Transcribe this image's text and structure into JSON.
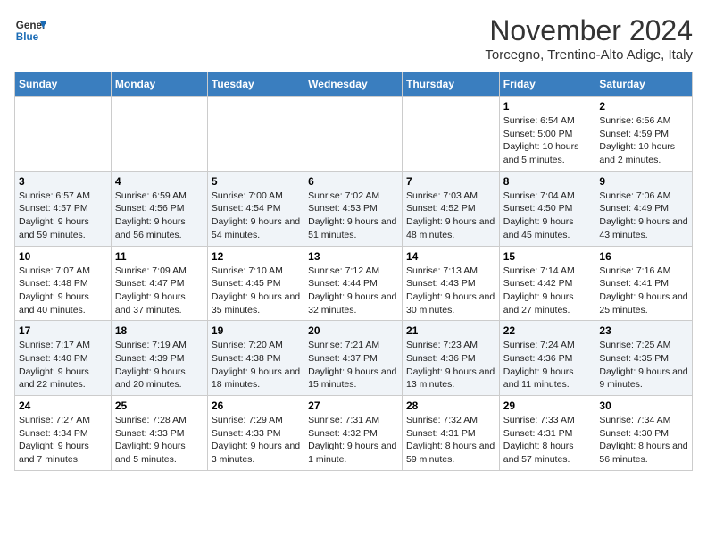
{
  "logo": {
    "line1": "General",
    "line2": "Blue"
  },
  "title": "November 2024",
  "location": "Torcegno, Trentino-Alto Adige, Italy",
  "days_of_week": [
    "Sunday",
    "Monday",
    "Tuesday",
    "Wednesday",
    "Thursday",
    "Friday",
    "Saturday"
  ],
  "weeks": [
    [
      {
        "day": "",
        "info": ""
      },
      {
        "day": "",
        "info": ""
      },
      {
        "day": "",
        "info": ""
      },
      {
        "day": "",
        "info": ""
      },
      {
        "day": "",
        "info": ""
      },
      {
        "day": "1",
        "info": "Sunrise: 6:54 AM\nSunset: 5:00 PM\nDaylight: 10 hours and 5 minutes."
      },
      {
        "day": "2",
        "info": "Sunrise: 6:56 AM\nSunset: 4:59 PM\nDaylight: 10 hours and 2 minutes."
      }
    ],
    [
      {
        "day": "3",
        "info": "Sunrise: 6:57 AM\nSunset: 4:57 PM\nDaylight: 9 hours and 59 minutes."
      },
      {
        "day": "4",
        "info": "Sunrise: 6:59 AM\nSunset: 4:56 PM\nDaylight: 9 hours and 56 minutes."
      },
      {
        "day": "5",
        "info": "Sunrise: 7:00 AM\nSunset: 4:54 PM\nDaylight: 9 hours and 54 minutes."
      },
      {
        "day": "6",
        "info": "Sunrise: 7:02 AM\nSunset: 4:53 PM\nDaylight: 9 hours and 51 minutes."
      },
      {
        "day": "7",
        "info": "Sunrise: 7:03 AM\nSunset: 4:52 PM\nDaylight: 9 hours and 48 minutes."
      },
      {
        "day": "8",
        "info": "Sunrise: 7:04 AM\nSunset: 4:50 PM\nDaylight: 9 hours and 45 minutes."
      },
      {
        "day": "9",
        "info": "Sunrise: 7:06 AM\nSunset: 4:49 PM\nDaylight: 9 hours and 43 minutes."
      }
    ],
    [
      {
        "day": "10",
        "info": "Sunrise: 7:07 AM\nSunset: 4:48 PM\nDaylight: 9 hours and 40 minutes."
      },
      {
        "day": "11",
        "info": "Sunrise: 7:09 AM\nSunset: 4:47 PM\nDaylight: 9 hours and 37 minutes."
      },
      {
        "day": "12",
        "info": "Sunrise: 7:10 AM\nSunset: 4:45 PM\nDaylight: 9 hours and 35 minutes."
      },
      {
        "day": "13",
        "info": "Sunrise: 7:12 AM\nSunset: 4:44 PM\nDaylight: 9 hours and 32 minutes."
      },
      {
        "day": "14",
        "info": "Sunrise: 7:13 AM\nSunset: 4:43 PM\nDaylight: 9 hours and 30 minutes."
      },
      {
        "day": "15",
        "info": "Sunrise: 7:14 AM\nSunset: 4:42 PM\nDaylight: 9 hours and 27 minutes."
      },
      {
        "day": "16",
        "info": "Sunrise: 7:16 AM\nSunset: 4:41 PM\nDaylight: 9 hours and 25 minutes."
      }
    ],
    [
      {
        "day": "17",
        "info": "Sunrise: 7:17 AM\nSunset: 4:40 PM\nDaylight: 9 hours and 22 minutes."
      },
      {
        "day": "18",
        "info": "Sunrise: 7:19 AM\nSunset: 4:39 PM\nDaylight: 9 hours and 20 minutes."
      },
      {
        "day": "19",
        "info": "Sunrise: 7:20 AM\nSunset: 4:38 PM\nDaylight: 9 hours and 18 minutes."
      },
      {
        "day": "20",
        "info": "Sunrise: 7:21 AM\nSunset: 4:37 PM\nDaylight: 9 hours and 15 minutes."
      },
      {
        "day": "21",
        "info": "Sunrise: 7:23 AM\nSunset: 4:36 PM\nDaylight: 9 hours and 13 minutes."
      },
      {
        "day": "22",
        "info": "Sunrise: 7:24 AM\nSunset: 4:36 PM\nDaylight: 9 hours and 11 minutes."
      },
      {
        "day": "23",
        "info": "Sunrise: 7:25 AM\nSunset: 4:35 PM\nDaylight: 9 hours and 9 minutes."
      }
    ],
    [
      {
        "day": "24",
        "info": "Sunrise: 7:27 AM\nSunset: 4:34 PM\nDaylight: 9 hours and 7 minutes."
      },
      {
        "day": "25",
        "info": "Sunrise: 7:28 AM\nSunset: 4:33 PM\nDaylight: 9 hours and 5 minutes."
      },
      {
        "day": "26",
        "info": "Sunrise: 7:29 AM\nSunset: 4:33 PM\nDaylight: 9 hours and 3 minutes."
      },
      {
        "day": "27",
        "info": "Sunrise: 7:31 AM\nSunset: 4:32 PM\nDaylight: 9 hours and 1 minute."
      },
      {
        "day": "28",
        "info": "Sunrise: 7:32 AM\nSunset: 4:31 PM\nDaylight: 8 hours and 59 minutes."
      },
      {
        "day": "29",
        "info": "Sunrise: 7:33 AM\nSunset: 4:31 PM\nDaylight: 8 hours and 57 minutes."
      },
      {
        "day": "30",
        "info": "Sunrise: 7:34 AM\nSunset: 4:30 PM\nDaylight: 8 hours and 56 minutes."
      }
    ]
  ]
}
